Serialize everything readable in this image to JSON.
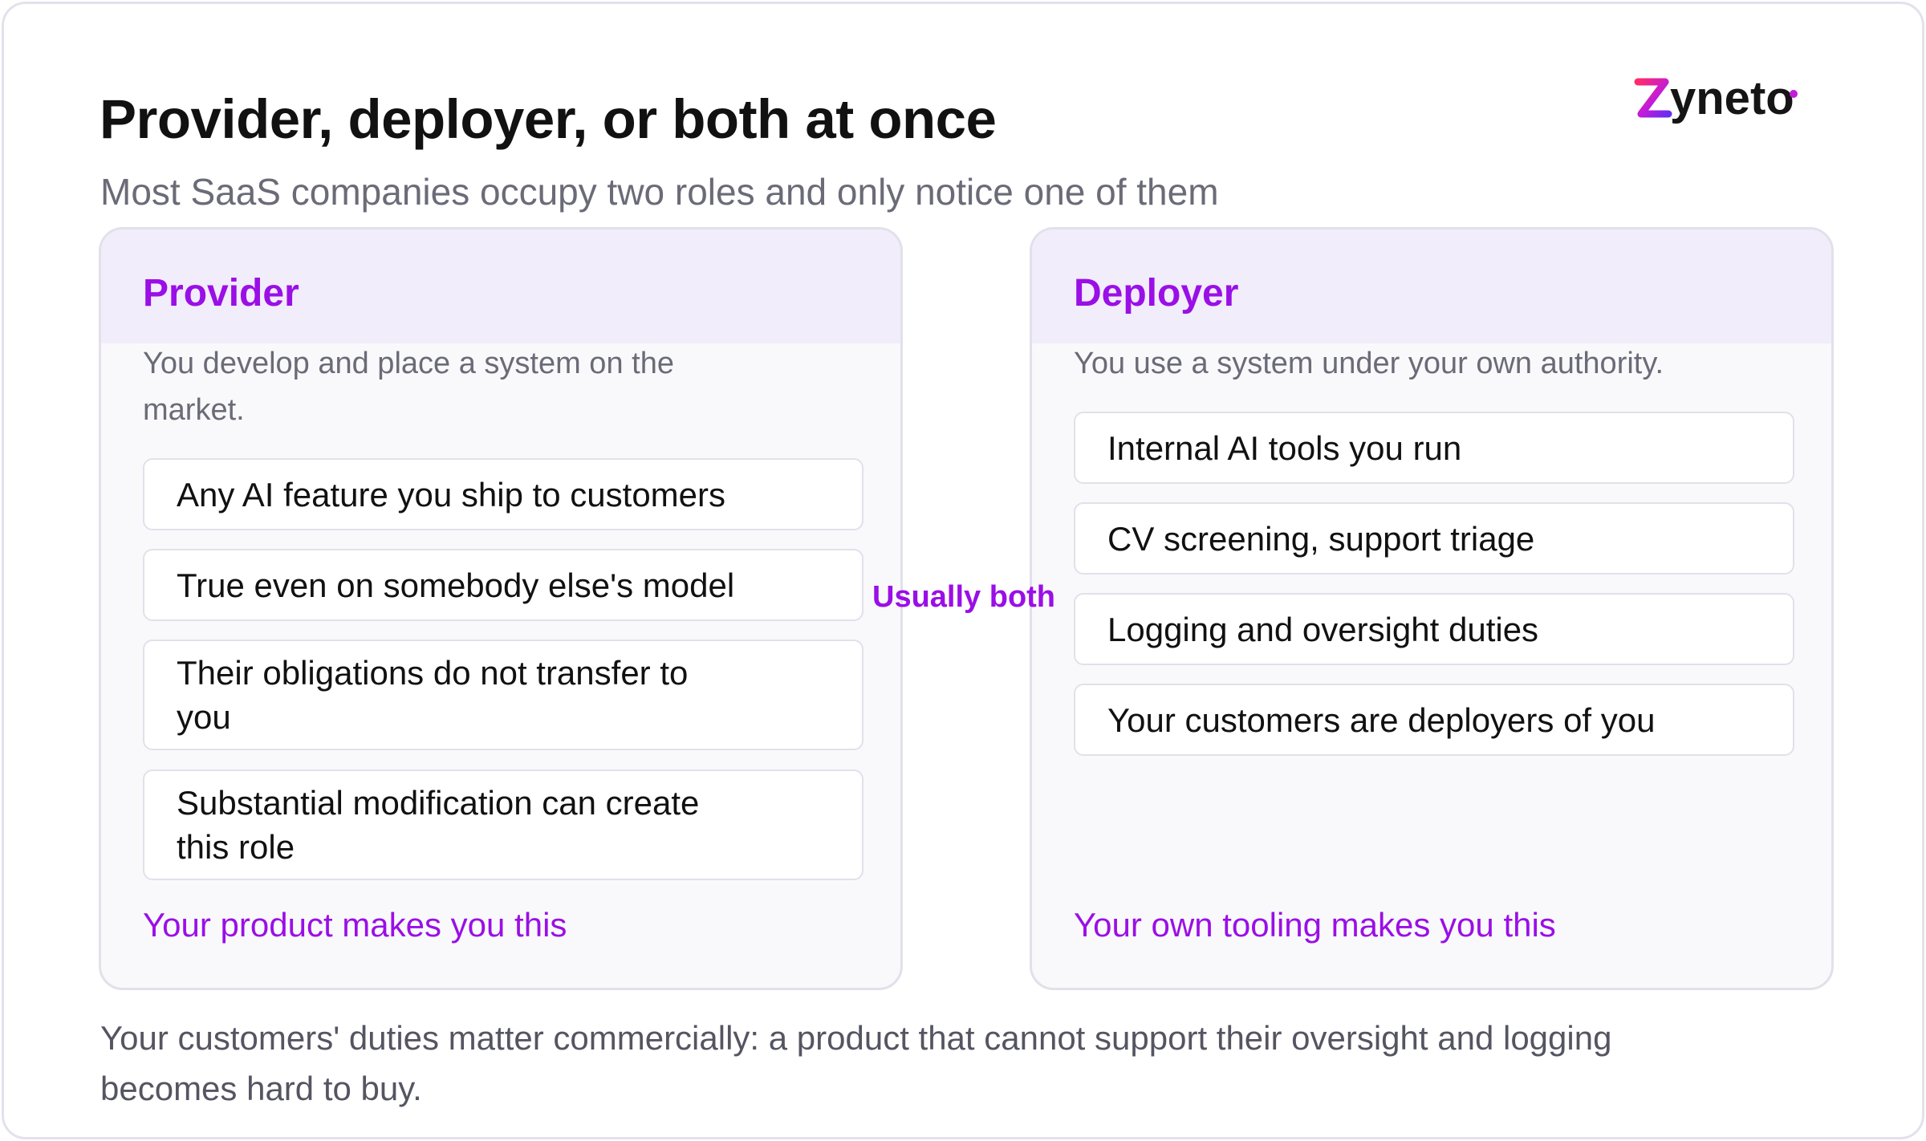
{
  "title": "Provider, deployer, or both at once",
  "subtitle": "Most SaaS companies occupy two roles and only notice one of them",
  "brand": {
    "name": "zyneto",
    "accent": "#9a0fe6"
  },
  "provider": {
    "title": "Provider",
    "description": "You develop and place a system on the market.",
    "items": [
      "Any AI feature you ship to customers",
      "True even on somebody else's model",
      "Their obligations do not transfer to you",
      "Substantial modification can create this role"
    ],
    "footer": "Your product makes you this"
  },
  "deployer": {
    "title": "Deployer",
    "description": "You use a system under your own authority.",
    "items": [
      "Internal AI tools you run",
      "CV screening, support triage",
      "Logging and oversight duties",
      "Your customers are deployers of you"
    ],
    "footer": "Your own tooling makes you this"
  },
  "connector_label": "Usually both",
  "footnote": "Your customers' duties matter commercially: a product that cannot support their oversight and logging becomes hard to buy."
}
